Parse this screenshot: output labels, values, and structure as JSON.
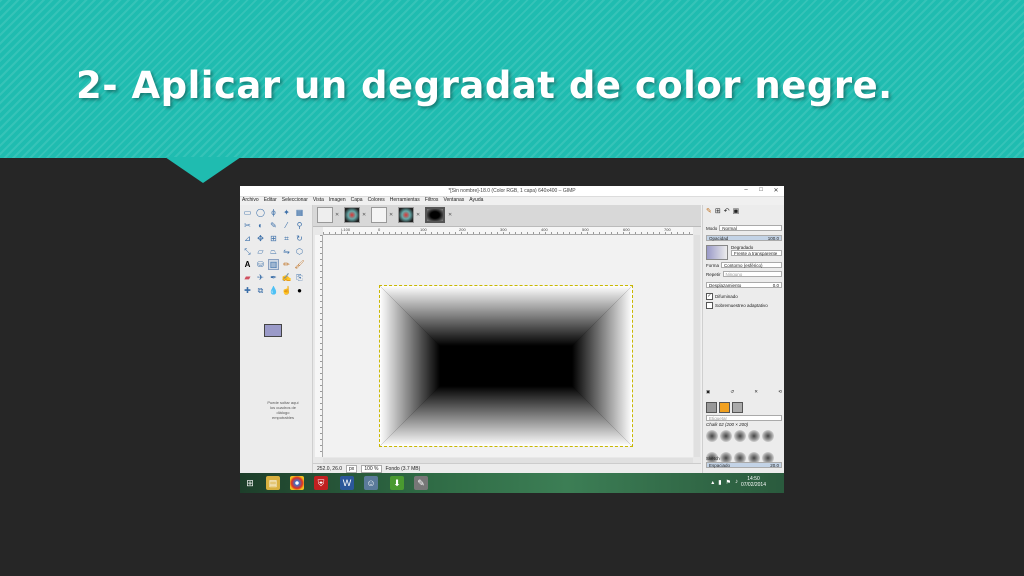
{
  "slide": {
    "title": "2- Aplicar un degradat de color negre.",
    "banner_color": "#1fbcb0",
    "background_color": "#262626"
  },
  "window": {
    "title": "*[Sin nombre]-18.0 (Color RGB, 1 capa) 640x400 – GIMP",
    "controls": [
      "–",
      "□",
      "✕"
    ]
  },
  "menubar": [
    "Archivo",
    "Editar",
    "Seleccionar",
    "Vista",
    "Imagen",
    "Capa",
    "Colores",
    "Herramientas",
    "Filtros",
    "Ventanas",
    "Ayuda"
  ],
  "toolbox": {
    "tools": [
      "rect-select",
      "ellipse-select",
      "free-select",
      "fuzzy-select",
      "select-by-color",
      "scissors",
      "foreground-select",
      "paths",
      "color-picker",
      "zoom",
      "measure",
      "move",
      "align",
      "crop",
      "rotate",
      "scale",
      "shear",
      "perspective",
      "flip",
      "cage",
      "text",
      "bucket-fill",
      "blend",
      "pencil",
      "paintbrush",
      "eraser",
      "airbrush",
      "ink",
      "mypaint-brush",
      "clone",
      "heal",
      "perspective-clone",
      "blur",
      "smudge",
      "dodge-burn"
    ],
    "selected_tool": "blend",
    "fg_color": "#9a9ac8",
    "bg_color": "#ffffff",
    "drop_note": "Puede soltar aquí los cuadros de diálogo empotrables"
  },
  "canvas": {
    "ruler_labels": [
      "|-100",
      "0",
      "100",
      "200",
      "300",
      "400",
      "500",
      "600",
      "700"
    ],
    "gradient_outer": "#ffffff",
    "gradient_inner": "#000000"
  },
  "statusbar": {
    "coords": "252.0, 26.0",
    "unit": "px",
    "zoom": "100 %",
    "layer_info": "Fondo (3.7 MB)"
  },
  "dock": {
    "mode_label": "Modo",
    "mode_value": "Normal",
    "opacity_label": "Opacidad",
    "opacity_value": "100.0",
    "gradient_label": "Degradado",
    "gradient_value": "Frente a transparente",
    "shape_label": "Forma",
    "shape_value": "Contorno (esférico)",
    "repeat_label": "Repetir",
    "repeat_value": "Ninguno",
    "offset_label": "Desplazamiento",
    "offset_value": "0.0",
    "dither_label": "Difuminado",
    "adaptive_label": "Sobremuestreo adaptativo",
    "brush_filter": "Etiquetar",
    "brush_name": "Chalk 02 (200 × 200)",
    "sketch_label": "Sketch",
    "spacing_label": "Espaciado",
    "spacing_value": "20.0"
  },
  "taskbar": {
    "time": "14:50",
    "date": "07/02/2014"
  }
}
